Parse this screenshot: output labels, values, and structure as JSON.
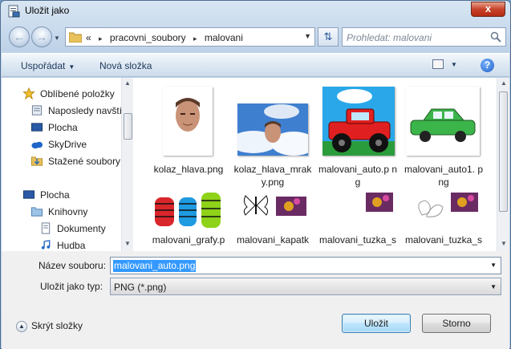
{
  "window": {
    "title": "Uložit jako",
    "close_symbol": "x"
  },
  "address": {
    "overflow": "«",
    "crumbs": [
      "pracovni_soubory",
      "malovani"
    ],
    "separator": "▸"
  },
  "search": {
    "placeholder": "Prohledat: malovani"
  },
  "toolbar": {
    "organize_label": "Uspořádat",
    "new_folder_label": "Nová složka",
    "help_symbol": "?"
  },
  "sidebar": {
    "items": [
      {
        "label": "Oblíbené položky",
        "icon": "star-icon"
      },
      {
        "label": "Naposledy navští",
        "icon": "recent-places-icon"
      },
      {
        "label": "Plocha",
        "icon": "desktop-icon"
      },
      {
        "label": "SkyDrive",
        "icon": "skydrive-icon"
      },
      {
        "label": "Stažené soubory",
        "icon": "downloads-icon"
      },
      {
        "label": "Plocha",
        "icon": "desktop-icon"
      },
      {
        "label": "Knihovny",
        "icon": "libraries-icon"
      },
      {
        "label": "Dokumenty",
        "icon": "documents-icon"
      },
      {
        "label": "Hudba",
        "icon": "music-icon"
      }
    ]
  },
  "files": [
    {
      "name": "kolaz_hlava.png"
    },
    {
      "name": "kolaz_hlava_mrak y.png"
    },
    {
      "name": "malovani_auto.p ng"
    },
    {
      "name": "malovani_auto1. png"
    },
    {
      "name": "malovani_grafy.p"
    },
    {
      "name": "malovani_kapatk"
    },
    {
      "name": "malovani_tuzka_s"
    },
    {
      "name": "malovani_tuzka_s"
    }
  ],
  "form": {
    "filename_label": "Název souboru:",
    "filename_value": "malovani_auto.png",
    "filetype_label": "Uložit jako typ:",
    "filetype_value": "PNG (*.png)"
  },
  "footer": {
    "hide_folders_label": "Skrýt složky",
    "save_label": "Uložit",
    "cancel_label": "Storno"
  },
  "colors": {
    "selection": "#3399ff",
    "close_button": "#c7432a",
    "primary_button": "#bee6fd"
  }
}
